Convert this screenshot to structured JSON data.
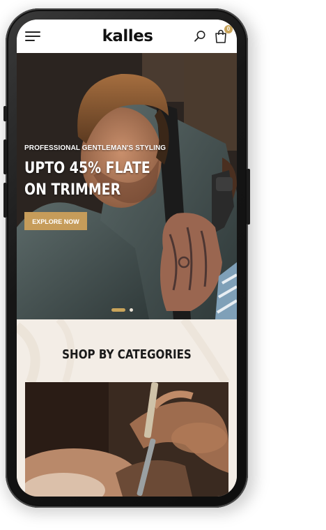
{
  "header": {
    "brand": "kalles",
    "menu_icon": "hamburger-menu-icon",
    "search_icon": "search-icon",
    "cart_icon": "shopping-bag-icon",
    "cart_count": "0"
  },
  "hero": {
    "eyebrow": "PROFESSIONAL GENTLEMAN'S STYLING",
    "title_line1": "UPTO 45% FLATE",
    "title_line2": "ON TRIMMER",
    "button_label": "EXPLORE NOW",
    "slide_count": 2,
    "active_slide": 1
  },
  "categories": {
    "title": "SHOP BY CATEGORIES"
  },
  "colors": {
    "accent": "#c69c5a",
    "header_bg": "#ffffff",
    "section_bg": "#f3ede6",
    "text_dark": "#1a1a1a"
  }
}
